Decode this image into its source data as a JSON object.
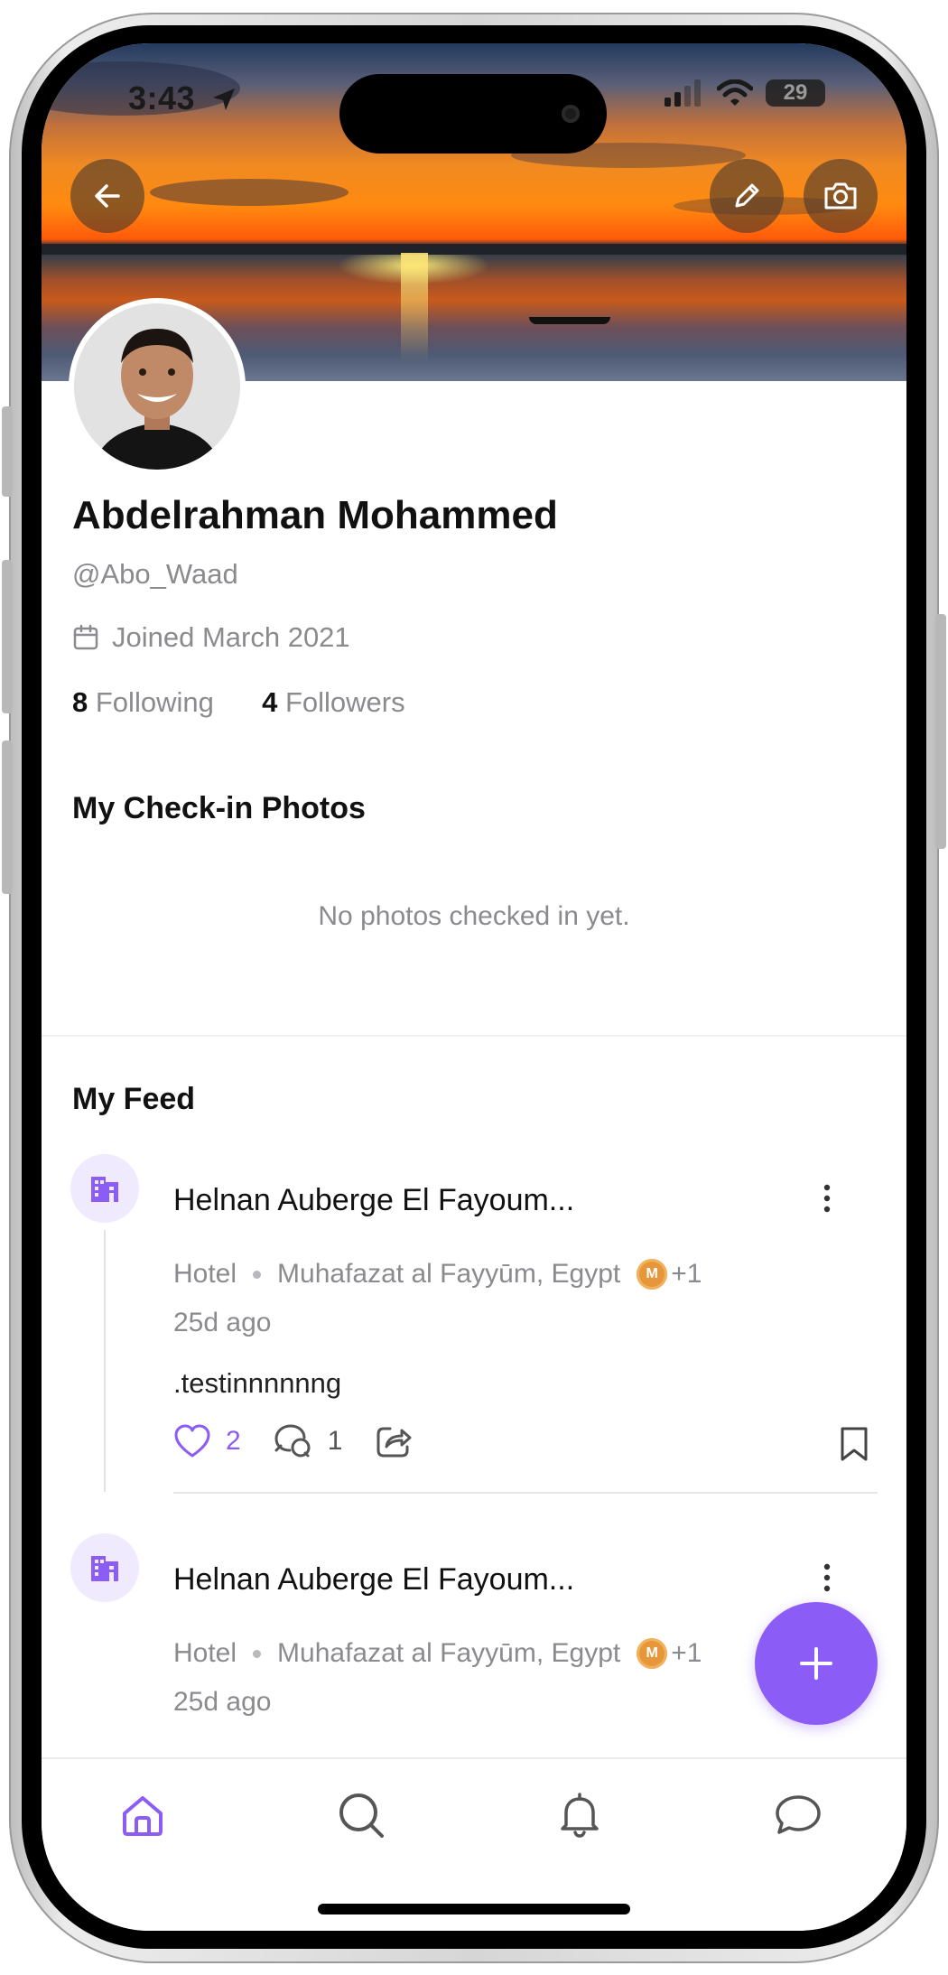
{
  "status_bar": {
    "time": "3:43",
    "battery": "29"
  },
  "profile": {
    "name": "Abdelrahman Mohammed",
    "handle": "@Abo_Waad",
    "joined": "Joined March 2021",
    "following_count": "8",
    "following_label": "Following",
    "followers_count": "4",
    "followers_label": "Followers"
  },
  "checkin": {
    "title": "My Check-in Photos",
    "empty_text": "No photos checked in yet."
  },
  "feed": {
    "title": "My Feed",
    "posts": [
      {
        "title": "Helnan Auberge El Fayoum...",
        "category": "Hotel",
        "location": "Muhafazat al Fayyūm, Egypt",
        "extra": "+1",
        "time": "25d ago",
        "text": ".testinnnnnng",
        "likes": "2",
        "comments": "1"
      },
      {
        "title": "Helnan Auberge El Fayoum...",
        "category": "Hotel",
        "location": "Muhafazat al Fayyūm, Egypt",
        "extra": "+1",
        "time": "25d ago"
      }
    ]
  },
  "colors": {
    "accent": "#8C5CF6",
    "muted": "#8A8A8F"
  },
  "icons": [
    "back-arrow-icon",
    "pencil-icon",
    "camera-icon",
    "calendar-icon",
    "hotel-icon",
    "more-vertical-icon",
    "heart-icon",
    "comment-icon",
    "share-icon",
    "bookmark-icon",
    "plus-icon",
    "home-icon",
    "search-icon",
    "bell-icon",
    "chat-icon"
  ]
}
